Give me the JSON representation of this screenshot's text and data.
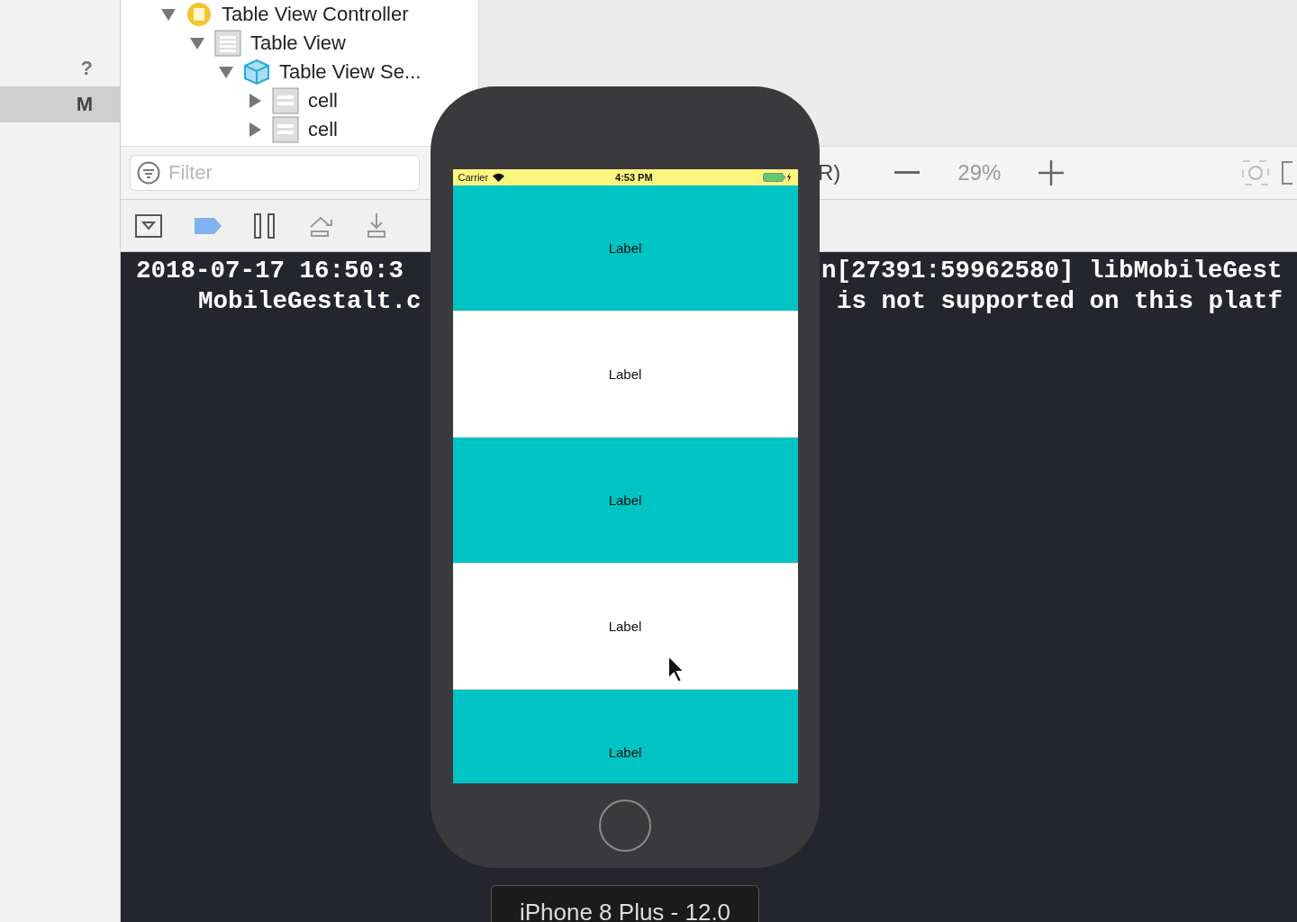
{
  "sidebar": {
    "items": [
      {
        "label": "?",
        "selected": false
      },
      {
        "label": "M",
        "selected": true
      }
    ]
  },
  "outline": {
    "items": [
      {
        "label": "Table View Controller",
        "kind": "controller",
        "expanded": true,
        "children": [
          {
            "label": "Table View",
            "kind": "table",
            "expanded": true,
            "children": [
              {
                "label": "Table View Se...",
                "kind": "section",
                "expanded": true,
                "children": [
                  {
                    "label": "cell",
                    "kind": "cell",
                    "expanded": false
                  },
                  {
                    "label": "cell",
                    "kind": "cell",
                    "expanded": false
                  }
                ]
              }
            ]
          }
        ]
      }
    ]
  },
  "filter": {
    "placeholder": "Filter"
  },
  "canvas_toolbar": {
    "label": "R)",
    "zoom": "29%"
  },
  "console": {
    "lines": [
      {
        "left": "2018-07-17 16:50:3",
        "right": "n[27391:59962580] libMobileGest"
      },
      {
        "left": "MobileGestalt.c",
        "right": "is not supported on this platf"
      }
    ]
  },
  "simulator": {
    "status_bar": {
      "carrier": "Carrier",
      "time": "4:53 PM"
    },
    "rows": [
      {
        "label": "Label",
        "color": "#00c3c3"
      },
      {
        "label": "Label",
        "color": "#ffffff"
      },
      {
        "label": "Label",
        "color": "#00c3c3"
      },
      {
        "label": "Label",
        "color": "#ffffff"
      },
      {
        "label": "Label",
        "color": "#00c3c3"
      }
    ],
    "device": "iPhone 8 Plus - 12.0"
  }
}
